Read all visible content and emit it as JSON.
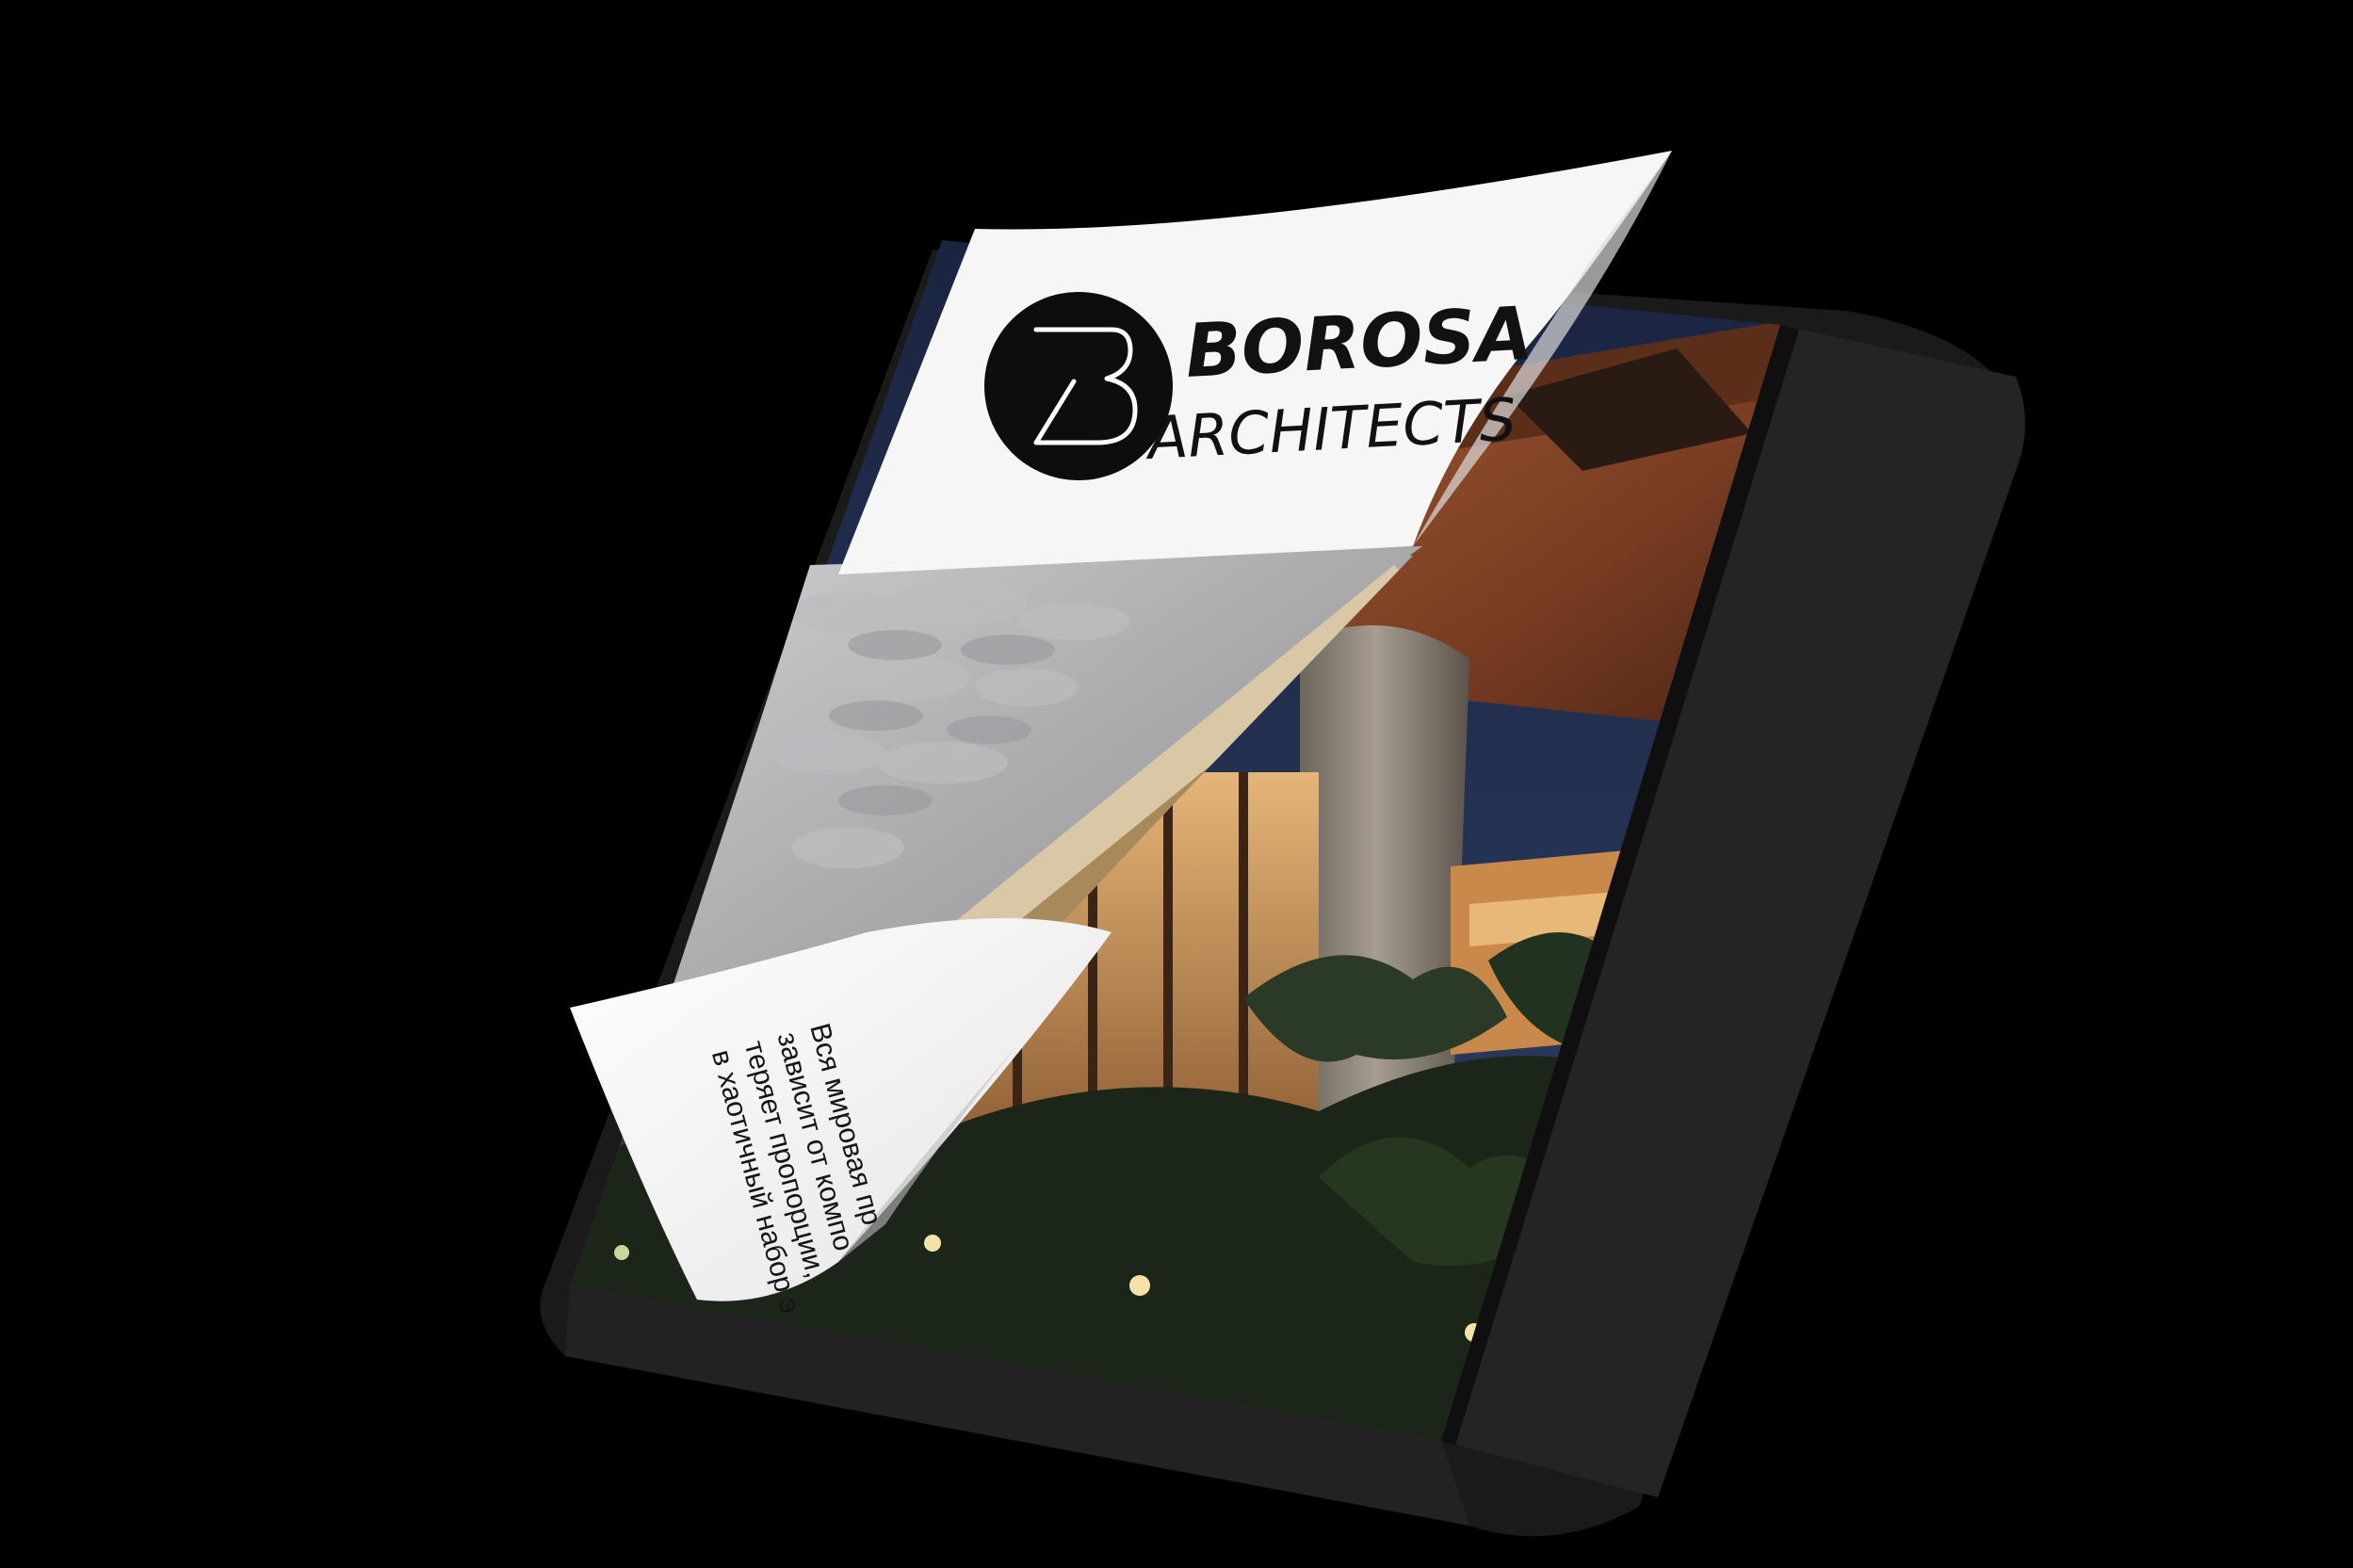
{
  "scene": {
    "description_free": true,
    "background_color": "#000000"
  },
  "brand": {
    "name": "BOROSA",
    "subtitle": "ARCHITECTS",
    "logo_icon": "b-monogram-icon"
  },
  "inner_page_text": {
    "line1": "Вся мировая пр",
    "line2": "зависит от компо",
    "line3": "теряет пропорции,",
    "line4": "в хаотичный набор э"
  },
  "colors": {
    "page_white": "#f4f4f4",
    "logo_black": "#0d0d0d",
    "sky_night": "#1c2b4a",
    "wood": "#8a4a2a",
    "stone": "#8c8478",
    "foliage": "#1e2a1c",
    "cloud_grey": "#b8b8ba"
  }
}
